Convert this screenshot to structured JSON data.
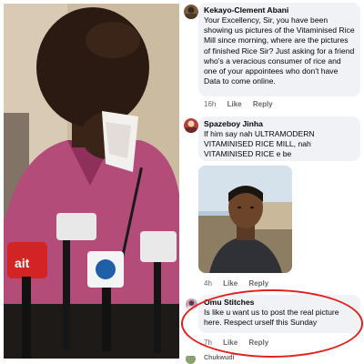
{
  "comments": [
    {
      "author": "Kekayo-Clement Abani",
      "text": "Your Excellency, Sir, you have been showing us pictures of the Vitaminised Rice Mill since morning, where are the pictures of finished Rice Sir? Just asking for a friend who's a veracious consumer of rice and one of your appointees who don't have Data to come online.",
      "time": "16h",
      "like": "Like",
      "reply": "Reply"
    },
    {
      "author": "Spazeboy Jinha",
      "text": "If him say nah ULTRAMODERN VITAMINISED RICE MILL, nah VITAMINISED RICE e be",
      "time": "4h",
      "like": "Like",
      "reply": "Reply"
    },
    {
      "author": "Omu Stitches",
      "text": "Is like u want us to post the real picture here. Respect urself this Sunday",
      "time": "7h",
      "like": "Like",
      "reply": "Reply"
    }
  ],
  "partial_next_author": "Chukwudi",
  "colors": {
    "highlight": "#e0201c",
    "bubble": "#f0f2f5",
    "meta_text": "#65676b"
  },
  "icons": {
    "avatar": "user-avatar",
    "photo": "attached-photo"
  }
}
